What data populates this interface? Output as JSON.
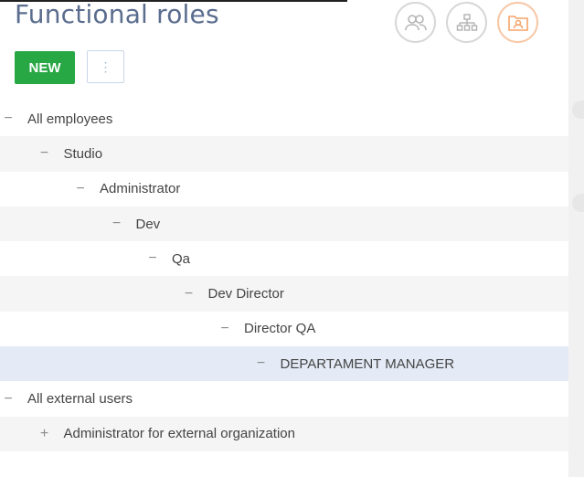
{
  "header": {
    "title": "Functional roles"
  },
  "toolbar": {
    "new_label": "NEW",
    "more_label": "⋮"
  },
  "view_switch": [
    {
      "icon": "users-icon",
      "active": false
    },
    {
      "icon": "org-chart-icon",
      "active": false
    },
    {
      "icon": "functional-roles-icon",
      "active": true
    }
  ],
  "tree": [
    {
      "label": "All employees",
      "level": 0,
      "toggle": "−",
      "selected": false
    },
    {
      "label": "Studio",
      "level": 1,
      "toggle": "−",
      "selected": false
    },
    {
      "label": "Administrator",
      "level": 2,
      "toggle": "−",
      "selected": false
    },
    {
      "label": "Dev",
      "level": 3,
      "toggle": "−",
      "selected": false
    },
    {
      "label": "Qa",
      "level": 4,
      "toggle": "−",
      "selected": false
    },
    {
      "label": "Dev Director",
      "level": 5,
      "toggle": "−",
      "selected": false
    },
    {
      "label": "Director QA",
      "level": 6,
      "toggle": "−",
      "selected": false
    },
    {
      "label": "DEPARTAMENT MANAGER",
      "level": 7,
      "toggle": "−",
      "selected": true
    },
    {
      "label": "All external users",
      "level": 0,
      "toggle": "−",
      "selected": false
    },
    {
      "label": "Administrator for external organization",
      "level": 1,
      "toggle": "+",
      "selected": false
    }
  ],
  "colors": {
    "new_button": "#28a745",
    "selected_row": "#e4ebf6",
    "alt_row": "#f5f5f5",
    "title": "#5b6d8e",
    "active_icon": "#f5a46a"
  }
}
